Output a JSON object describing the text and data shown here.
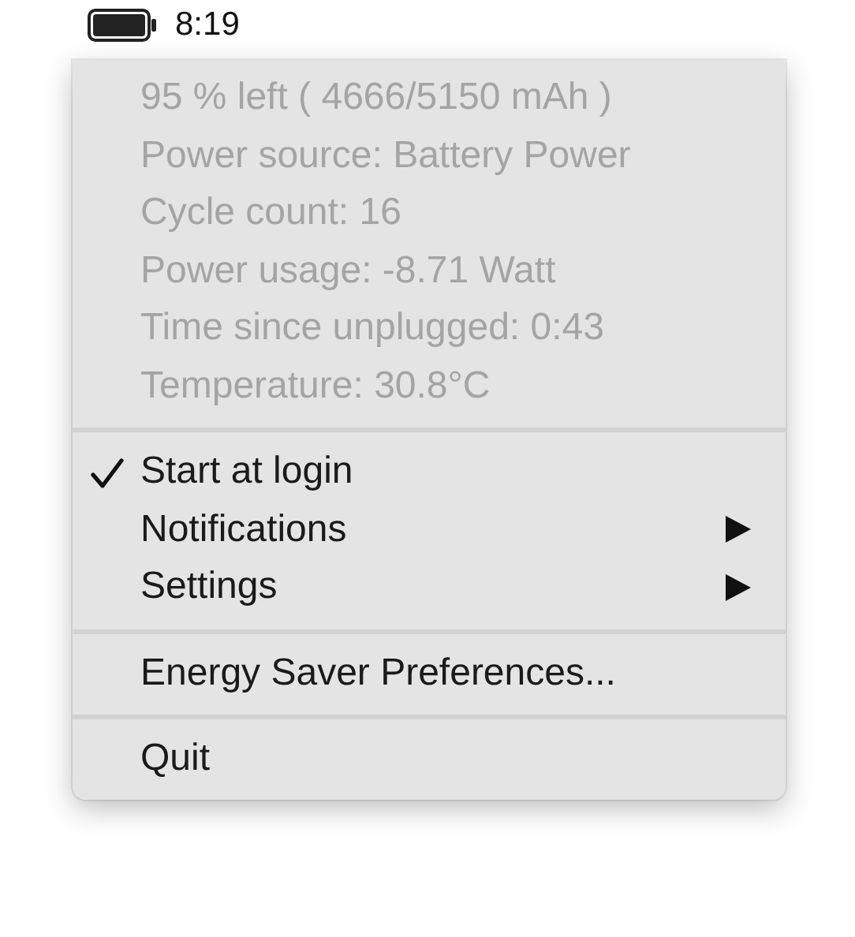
{
  "menu_bar": {
    "time": "8:19"
  },
  "menu": {
    "sections": [
      [
        {
          "kind": "info",
          "label": "95 % left ( 4666/5150 mAh )",
          "disabled": true
        },
        {
          "kind": "info",
          "label": "Power source: Battery Power",
          "disabled": true
        },
        {
          "kind": "info",
          "label": "Cycle count: 16",
          "disabled": true
        },
        {
          "kind": "info",
          "label": "Power usage: -8.71 Watt",
          "disabled": true
        },
        {
          "kind": "info",
          "label": "Time since unplugged: 0:43",
          "disabled": true
        },
        {
          "kind": "info",
          "label": "Temperature: 30.8°C",
          "disabled": true
        }
      ],
      [
        {
          "kind": "toggle",
          "label": "Start at login",
          "checked": true,
          "disabled": false
        },
        {
          "kind": "submenu",
          "label": "Notifications",
          "disabled": false
        },
        {
          "kind": "submenu",
          "label": "Settings",
          "disabled": false
        }
      ],
      [
        {
          "kind": "action",
          "label": "Energy Saver Preferences...",
          "disabled": false
        }
      ],
      [
        {
          "kind": "action",
          "label": "Quit",
          "disabled": false
        }
      ]
    ]
  }
}
